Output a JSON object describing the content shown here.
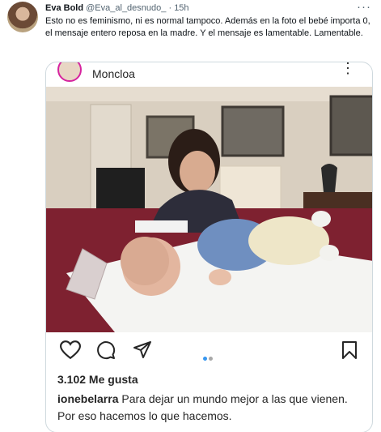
{
  "tweet": {
    "author_name": "Eva Bold",
    "author_handle": "@Eva_al_desnudo_",
    "separator": "·",
    "time": "15h",
    "more_icon": "more-horizontal-icon",
    "text": "Esto no es feminismo, ni es normal tampoco. Además en la foto el bebé importa 0, el mensaje entero reposa en la madre. Y el mensaje es lamentable. Lamentable."
  },
  "instagram": {
    "location": "Moncloa",
    "more_icon": "more-vertical-icon",
    "actions": [
      "heart-icon",
      "comment-icon",
      "share-icon",
      "bookmark-icon"
    ],
    "likes": "3.102 Me gusta",
    "caption_user": "ionebelarra",
    "caption_text": "Para dejar un mundo mejor a las que vienen. Por eso hacemos lo que hacemos.",
    "carousel_active_color": "#3897f0",
    "carousel_inactive_color": "#a8a8a8"
  }
}
